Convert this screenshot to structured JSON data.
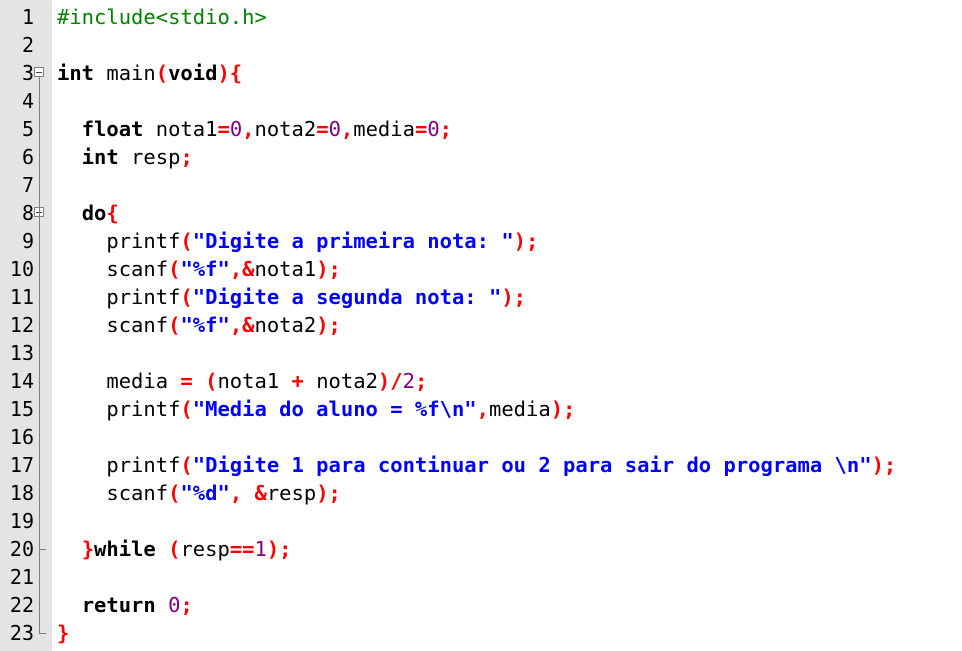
{
  "editor": {
    "lines": [
      {
        "num": "1",
        "tokens": [
          {
            "t": "#include<stdio.h>",
            "c": "dir"
          }
        ]
      },
      {
        "num": "2",
        "tokens": []
      },
      {
        "num": "3",
        "fold": "open",
        "tokens": [
          {
            "t": "int",
            "c": "kw"
          },
          {
            "t": " main",
            "c": "id"
          },
          {
            "t": "(",
            "c": "op"
          },
          {
            "t": "void",
            "c": "kw"
          },
          {
            "t": "){",
            "c": "op"
          }
        ]
      },
      {
        "num": "4",
        "tokens": []
      },
      {
        "num": "5",
        "tokens": [
          {
            "t": "  ",
            "c": "id"
          },
          {
            "t": "float",
            "c": "kw"
          },
          {
            "t": " nota1",
            "c": "id"
          },
          {
            "t": "=",
            "c": "op"
          },
          {
            "t": "0",
            "c": "num"
          },
          {
            "t": ",",
            "c": "op"
          },
          {
            "t": "nota2",
            "c": "id"
          },
          {
            "t": "=",
            "c": "op"
          },
          {
            "t": "0",
            "c": "num"
          },
          {
            "t": ",",
            "c": "op"
          },
          {
            "t": "media",
            "c": "id"
          },
          {
            "t": "=",
            "c": "op"
          },
          {
            "t": "0",
            "c": "num"
          },
          {
            "t": ";",
            "c": "op"
          }
        ]
      },
      {
        "num": "6",
        "tokens": [
          {
            "t": "  ",
            "c": "id"
          },
          {
            "t": "int",
            "c": "kw"
          },
          {
            "t": " resp",
            "c": "id"
          },
          {
            "t": ";",
            "c": "op"
          }
        ]
      },
      {
        "num": "7",
        "tokens": []
      },
      {
        "num": "8",
        "fold": "open",
        "tokens": [
          {
            "t": "  ",
            "c": "id"
          },
          {
            "t": "do",
            "c": "kw"
          },
          {
            "t": "{",
            "c": "op"
          }
        ]
      },
      {
        "num": "9",
        "tokens": [
          {
            "t": "    printf",
            "c": "id"
          },
          {
            "t": "(",
            "c": "op"
          },
          {
            "t": "\"Digite a primeira nota: \"",
            "c": "str"
          },
          {
            "t": ");",
            "c": "op"
          }
        ]
      },
      {
        "num": "10",
        "tokens": [
          {
            "t": "    scanf",
            "c": "id"
          },
          {
            "t": "(",
            "c": "op"
          },
          {
            "t": "\"%f\"",
            "c": "str"
          },
          {
            "t": ",&",
            "c": "op"
          },
          {
            "t": "nota1",
            "c": "id"
          },
          {
            "t": ");",
            "c": "op"
          }
        ]
      },
      {
        "num": "11",
        "tokens": [
          {
            "t": "    printf",
            "c": "id"
          },
          {
            "t": "(",
            "c": "op"
          },
          {
            "t": "\"Digite a segunda nota: \"",
            "c": "str"
          },
          {
            "t": ");",
            "c": "op"
          }
        ]
      },
      {
        "num": "12",
        "tokens": [
          {
            "t": "    scanf",
            "c": "id"
          },
          {
            "t": "(",
            "c": "op"
          },
          {
            "t": "\"%f\"",
            "c": "str"
          },
          {
            "t": ",&",
            "c": "op"
          },
          {
            "t": "nota2",
            "c": "id"
          },
          {
            "t": ");",
            "c": "op"
          }
        ]
      },
      {
        "num": "13",
        "tokens": []
      },
      {
        "num": "14",
        "tokens": [
          {
            "t": "    media ",
            "c": "id"
          },
          {
            "t": "=",
            "c": "op"
          },
          {
            "t": " ",
            "c": "id"
          },
          {
            "t": "(",
            "c": "op"
          },
          {
            "t": "nota1 ",
            "c": "id"
          },
          {
            "t": "+",
            "c": "op"
          },
          {
            "t": " nota2",
            "c": "id"
          },
          {
            "t": ")/",
            "c": "op"
          },
          {
            "t": "2",
            "c": "num"
          },
          {
            "t": ";",
            "c": "op"
          }
        ]
      },
      {
        "num": "15",
        "tokens": [
          {
            "t": "    printf",
            "c": "id"
          },
          {
            "t": "(",
            "c": "op"
          },
          {
            "t": "\"Media do aluno = %f\\n\"",
            "c": "str"
          },
          {
            "t": ",",
            "c": "op"
          },
          {
            "t": "media",
            "c": "id"
          },
          {
            "t": ");",
            "c": "op"
          }
        ]
      },
      {
        "num": "16",
        "tokens": []
      },
      {
        "num": "17",
        "tokens": [
          {
            "t": "    printf",
            "c": "id"
          },
          {
            "t": "(",
            "c": "op"
          },
          {
            "t": "\"Digite 1 para continuar ou 2 para sair do programa \\n\"",
            "c": "str"
          },
          {
            "t": ");",
            "c": "op"
          }
        ]
      },
      {
        "num": "18",
        "tokens": [
          {
            "t": "    scanf",
            "c": "id"
          },
          {
            "t": "(",
            "c": "op"
          },
          {
            "t": "\"%d\"",
            "c": "str"
          },
          {
            "t": ", &",
            "c": "op"
          },
          {
            "t": "resp",
            "c": "id"
          },
          {
            "t": ");",
            "c": "op"
          }
        ]
      },
      {
        "num": "19",
        "tokens": []
      },
      {
        "num": "20",
        "foldend": true,
        "tokens": [
          {
            "t": "  ",
            "c": "id"
          },
          {
            "t": "}",
            "c": "op"
          },
          {
            "t": "while",
            "c": "kw"
          },
          {
            "t": " ",
            "c": "id"
          },
          {
            "t": "(",
            "c": "op"
          },
          {
            "t": "resp",
            "c": "id"
          },
          {
            "t": "==",
            "c": "op"
          },
          {
            "t": "1",
            "c": "num"
          },
          {
            "t": ");",
            "c": "op"
          }
        ]
      },
      {
        "num": "21",
        "tokens": []
      },
      {
        "num": "22",
        "tokens": [
          {
            "t": "  ",
            "c": "id"
          },
          {
            "t": "return",
            "c": "kw"
          },
          {
            "t": " ",
            "c": "id"
          },
          {
            "t": "0",
            "c": "num"
          },
          {
            "t": ";",
            "c": "op"
          }
        ]
      },
      {
        "num": "23",
        "foldend": true,
        "tokens": [
          {
            "t": "}",
            "c": "op"
          }
        ]
      }
    ]
  },
  "colors": {
    "gutter_bg": "#e4e4e4",
    "directive": "#008000",
    "operator": "#ff0000",
    "number": "#800080",
    "string": "#0000ff",
    "keyword": "#000000"
  }
}
